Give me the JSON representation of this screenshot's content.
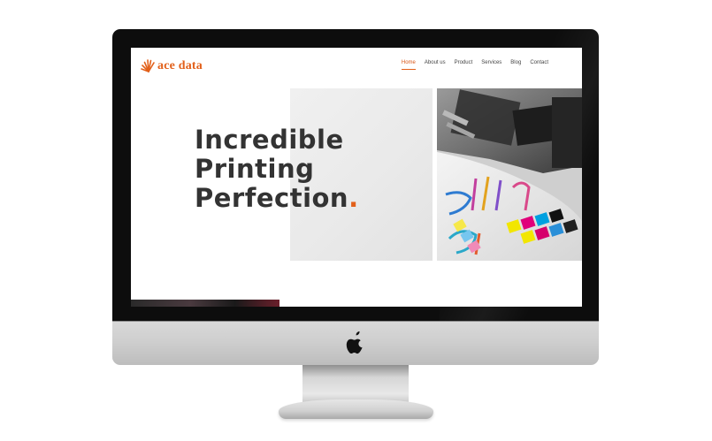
{
  "site": {
    "logo_text": "ace data",
    "nav": [
      {
        "label": "Home",
        "active": true
      },
      {
        "label": "About us",
        "active": false
      },
      {
        "label": "Product",
        "active": false
      },
      {
        "label": "Services",
        "active": false
      },
      {
        "label": "Blog",
        "active": false
      },
      {
        "label": "Contact",
        "active": false
      }
    ],
    "hero": {
      "line1": "Incredible",
      "line2": "Printing",
      "line3": "Perfection",
      "dot": "."
    }
  },
  "colors": {
    "accent": "#e2601a",
    "heading": "#333333",
    "bezel": "#0d0d0d"
  },
  "icons": {
    "brand": "apple-icon",
    "logo": "sunburst-icon"
  }
}
